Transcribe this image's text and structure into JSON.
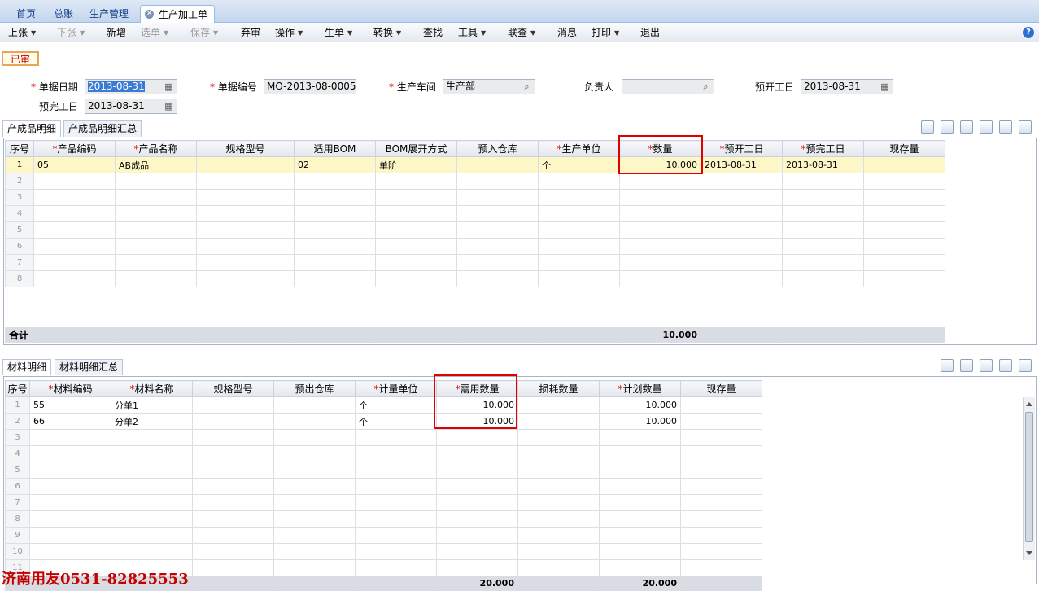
{
  "tabs": [
    "首页",
    "总账",
    "生产管理",
    "生产加工单"
  ],
  "toolbar": [
    {
      "label": "上张",
      "dropdown": true,
      "disabled": false
    },
    {
      "label": "下张",
      "dropdown": true,
      "disabled": true
    },
    {
      "label": "新增",
      "dropdown": false,
      "disabled": false
    },
    {
      "label": "选单",
      "dropdown": true,
      "disabled": true
    },
    {
      "label": "保存",
      "dropdown": true,
      "disabled": true
    },
    {
      "label": "弃审",
      "dropdown": false,
      "disabled": false
    },
    {
      "label": "操作",
      "dropdown": true,
      "disabled": false
    },
    {
      "label": "生单",
      "dropdown": true,
      "disabled": false
    },
    {
      "label": "转换",
      "dropdown": true,
      "disabled": false
    },
    {
      "label": "查找",
      "dropdown": false,
      "disabled": false
    },
    {
      "label": "工具",
      "dropdown": true,
      "disabled": false
    },
    {
      "label": "联查",
      "dropdown": true,
      "disabled": false
    },
    {
      "label": "消息",
      "dropdown": false,
      "disabled": false
    },
    {
      "label": "打印",
      "dropdown": true,
      "disabled": false
    },
    {
      "label": "退出",
      "dropdown": false,
      "disabled": false
    }
  ],
  "help_glyph": "?",
  "status_badge": "已审",
  "form": {
    "doc_date": {
      "label": "单据日期",
      "value": "2013-08-31"
    },
    "doc_no": {
      "label": "单据编号",
      "value": "MO-2013-08-0005"
    },
    "workshop": {
      "label": "生产车间",
      "value": "生产部"
    },
    "owner": {
      "label": "负责人",
      "value": ""
    },
    "plan_start": {
      "label": "预开工日",
      "value": "2013-08-31"
    },
    "plan_end": {
      "label": "预完工日",
      "value": "2013-08-31"
    }
  },
  "product_tabs": [
    "产成品明细",
    "产成品明细汇总"
  ],
  "product_columns": [
    {
      "label": "序号",
      "required": false
    },
    {
      "label": "产品编码",
      "required": true
    },
    {
      "label": "产品名称",
      "required": true
    },
    {
      "label": "规格型号",
      "required": false
    },
    {
      "label": "适用BOM",
      "required": false
    },
    {
      "label": "BOM展开方式",
      "required": false
    },
    {
      "label": "预入仓库",
      "required": false
    },
    {
      "label": "生产单位",
      "required": true
    },
    {
      "label": "数量",
      "required": true
    },
    {
      "label": "预开工日",
      "required": true
    },
    {
      "label": "预完工日",
      "required": true
    },
    {
      "label": "现存量",
      "required": false
    }
  ],
  "product_rows": [
    [
      "1",
      "05",
      "AB成品",
      "",
      "02",
      "单阶",
      "",
      "个",
      "10.000",
      "2013-08-31",
      "2013-08-31",
      ""
    ],
    [
      "2",
      "",
      "",
      "",
      "",
      "",
      "",
      "",
      "",
      "",
      "",
      ""
    ],
    [
      "3",
      "",
      "",
      "",
      "",
      "",
      "",
      "",
      "",
      "",
      "",
      ""
    ],
    [
      "4",
      "",
      "",
      "",
      "",
      "",
      "",
      "",
      "",
      "",
      "",
      ""
    ],
    [
      "5",
      "",
      "",
      "",
      "",
      "",
      "",
      "",
      "",
      "",
      "",
      ""
    ],
    [
      "6",
      "",
      "",
      "",
      "",
      "",
      "",
      "",
      "",
      "",
      "",
      ""
    ],
    [
      "7",
      "",
      "",
      "",
      "",
      "",
      "",
      "",
      "",
      "",
      "",
      ""
    ],
    [
      "8",
      "",
      "",
      "",
      "",
      "",
      "",
      "",
      "",
      "",
      "",
      ""
    ]
  ],
  "product_total": {
    "label": "合计",
    "quantity": "10.000"
  },
  "material_tabs": [
    "材料明细",
    "材料明细汇总"
  ],
  "material_columns": [
    {
      "label": "序号",
      "required": false
    },
    {
      "label": "材料编码",
      "required": true
    },
    {
      "label": "材料名称",
      "required": true
    },
    {
      "label": "规格型号",
      "required": false
    },
    {
      "label": "预出仓库",
      "required": false
    },
    {
      "label": "计量单位",
      "required": true
    },
    {
      "label": "需用数量",
      "required": true
    },
    {
      "label": "损耗数量",
      "required": false
    },
    {
      "label": "计划数量",
      "required": true
    },
    {
      "label": "现存量",
      "required": false
    }
  ],
  "material_rows": [
    [
      "1",
      "55",
      "分单1",
      "",
      "",
      "个",
      "10.000",
      "",
      "10.000",
      ""
    ],
    [
      "2",
      "66",
      "分单2",
      "",
      "",
      "个",
      "10.000",
      "",
      "10.000",
      ""
    ],
    [
      "3",
      "",
      "",
      "",
      "",
      "",
      "",
      "",
      "",
      ""
    ],
    [
      "4",
      "",
      "",
      "",
      "",
      "",
      "",
      "",
      "",
      ""
    ],
    [
      "5",
      "",
      "",
      "",
      "",
      "",
      "",
      "",
      "",
      ""
    ],
    [
      "6",
      "",
      "",
      "",
      "",
      "",
      "",
      "",
      "",
      ""
    ],
    [
      "7",
      "",
      "",
      "",
      "",
      "",
      "",
      "",
      "",
      ""
    ],
    [
      "8",
      "",
      "",
      "",
      "",
      "",
      "",
      "",
      "",
      ""
    ],
    [
      "9",
      "",
      "",
      "",
      "",
      "",
      "",
      "",
      "",
      ""
    ],
    [
      "10",
      "",
      "",
      "",
      "",
      "",
      "",
      "",
      "",
      ""
    ],
    [
      "11",
      "",
      "",
      "",
      "",
      "",
      "",
      "",
      "",
      ""
    ]
  ],
  "material_total": {
    "required_qty": "20.000",
    "planned_qty": "20.000"
  },
  "watermark": "济南用友0531-82825553",
  "colors": {
    "accent": "#3a7bd5",
    "required_star": "#e00000",
    "highlight_row": "#fdf7c8",
    "annotation_box": "#e00000"
  }
}
